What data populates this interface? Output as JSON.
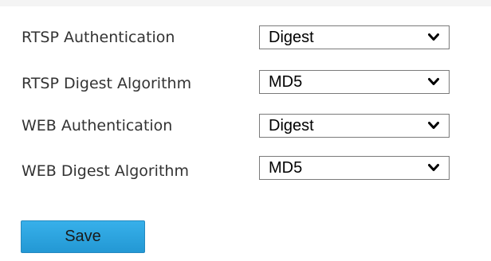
{
  "form": {
    "rows": [
      {
        "label": "RTSP Authentication",
        "value": "Digest"
      },
      {
        "label": "RTSP Digest Algorithm",
        "value": "MD5"
      },
      {
        "label": "WEB Authentication",
        "value": "Digest"
      },
      {
        "label": "WEB Digest Algorithm",
        "value": "MD5"
      }
    ],
    "save_label": "Save"
  },
  "icons": {
    "dropdown": "chevron-down-icon"
  },
  "colors": {
    "button_fill": "#2ea4e0",
    "select_border": "#7a7a7a",
    "label_text": "#333333"
  }
}
